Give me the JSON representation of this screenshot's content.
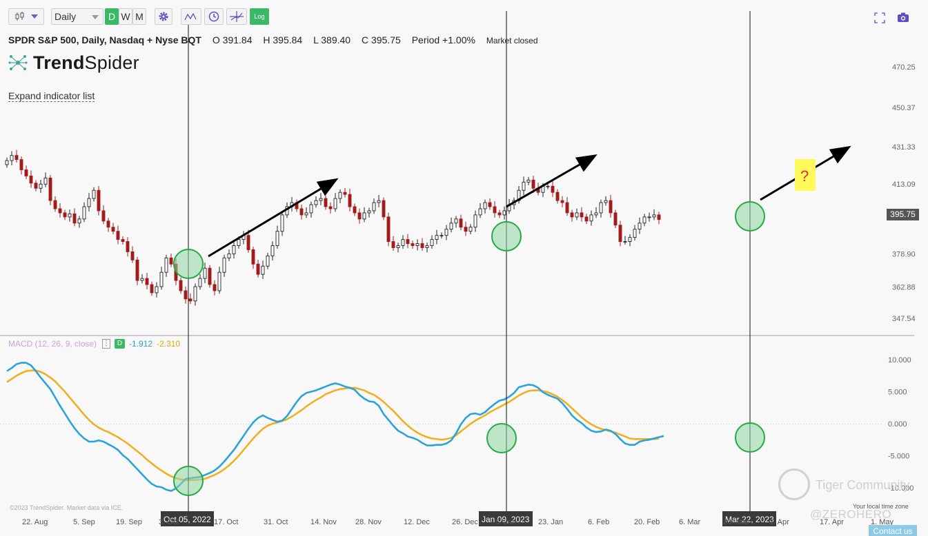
{
  "toolbar": {
    "interval_label": "Daily",
    "timeframes": [
      "D",
      "W",
      "M"
    ],
    "log_label": "Log"
  },
  "info": {
    "symbol": "SPDR S&P 500, Daily, Nasdaq + Nyse BQT",
    "open": "O 391.84",
    "high": "H 395.84",
    "low": "L 389.40",
    "close": "C 395.75",
    "period": "Period +1.00%",
    "status": "Market closed"
  },
  "logo": {
    "part1": "Trend",
    "part2": "Spider"
  },
  "expand_link": "Expand indicator list",
  "macd": {
    "name": "MACD (12, 26, 9, close)",
    "menu": "⋮",
    "badge": "D",
    "macd_value": "-1.912",
    "signal_value": "-2.310"
  },
  "copyright": "©2023 TrendSpider. Market data via ICE.",
  "watermark": {
    "text": "Tiger Community",
    "handle": "@ZEROHERO"
  },
  "timezone_note": "Your local time zone",
  "contact": "Contact us",
  "last_price": "395.75",
  "question_mark": "?",
  "colors": {
    "up": "#222222",
    "down": "#a31a1a",
    "macd": "#29a3dc",
    "signal": "#f0b020",
    "circle_stroke": "#22aa44",
    "circle_fill": "#8fd6a2",
    "accent_green": "#3cb968"
  },
  "chart_data": [
    {
      "type": "candlestick",
      "title": "SPDR S&P 500, Daily, Nasdaq + Nyse BQT",
      "y_ticks": [
        470.25,
        450.37,
        431.33,
        413.09,
        395.75,
        378.9,
        362.88,
        347.54
      ],
      "y_tick_labels": [
        "470.25",
        "450.37",
        "431.33",
        "413.09",
        "",
        "378.90",
        "362.88",
        "347.54"
      ],
      "ylim": [
        342,
        476
      ],
      "x_tick_labels": [
        "22. Aug",
        "5. Sep",
        "19. Sep",
        "3. Oct",
        "17. Oct",
        "31. Oct",
        "14. Nov",
        "28. Nov",
        "12. Dec",
        "26. Dec",
        "9. Jan",
        "23. Jan",
        "6. Feb",
        "20. Feb",
        "6. Mar",
        "20. Mar",
        "3. Apr",
        "17. Apr",
        "1. May"
      ],
      "crosshair_dates": [
        "Oct 05, 2022",
        "Jan 09, 2023",
        "Mar 22, 2023"
      ],
      "close": [
        424.5,
        427,
        425,
        420,
        417,
        413.5,
        411,
        413,
        416,
        405,
        401,
        399,
        397,
        398.5,
        394,
        396,
        402,
        406,
        410,
        400,
        395,
        392,
        390,
        386,
        385,
        380,
        376,
        366,
        367,
        364,
        360,
        363,
        370,
        377,
        374,
        366,
        361,
        357,
        356,
        363,
        367,
        372,
        364,
        361,
        370,
        377,
        379,
        383,
        386,
        388,
        381,
        374,
        369,
        373,
        378,
        383,
        390,
        398,
        402,
        404,
        401,
        398,
        399,
        403,
        405,
        406,
        402,
        401,
        406,
        409,
        408,
        402,
        399,
        396,
        399,
        400,
        404,
        405,
        397,
        385,
        382,
        383,
        386,
        384,
        383,
        384,
        382,
        383,
        386,
        388,
        388,
        391,
        394,
        396,
        392,
        390,
        392,
        398,
        401,
        404,
        402,
        399,
        398,
        400,
        403,
        405,
        410,
        414,
        415,
        411,
        409,
        412,
        412,
        409,
        405,
        404,
        399,
        397,
        399,
        397,
        395,
        398,
        399,
        404,
        405,
        399,
        393,
        385,
        385,
        387,
        391,
        394,
        397,
        397,
        398,
        395.75
      ]
    },
    {
      "type": "line",
      "title": "MACD (12, 26, 9, close)",
      "y_ticks": [
        10,
        5,
        0,
        -5,
        -10
      ],
      "y_tick_labels": [
        "10.000",
        "5.000",
        "0.000",
        "-5.000",
        "-10.000"
      ],
      "ylim": [
        -12,
        13
      ],
      "series": [
        {
          "name": "MACD",
          "values": [
            8.2,
            8.7,
            9.3,
            9.5,
            9.5,
            9.1,
            8.2,
            7.2,
            6.3,
            5.4,
            4.1,
            2.8,
            1.6,
            0.4,
            -0.7,
            -1.6,
            -2.3,
            -2.8,
            -2.8,
            -2.6,
            -2.8,
            -3.2,
            -3.6,
            -4.1,
            -4.9,
            -5.5,
            -6.3,
            -7.1,
            -7.9,
            -8.7,
            -9.4,
            -9.8,
            -9.9,
            -10.3,
            -10.5,
            -10.1,
            -9.4,
            -8.6,
            -8.5,
            -8.4,
            -8.3,
            -8.0,
            -7.7,
            -7.3,
            -6.7,
            -5.9,
            -5.0,
            -4.1,
            -3.0,
            -1.9,
            -0.8,
            0.2,
            0.9,
            1.3,
            0.9,
            0.6,
            0.3,
            0.5,
            1.2,
            2.3,
            3.4,
            4.3,
            4.8,
            5.0,
            5.2,
            5.5,
            5.8,
            6.1,
            6.3,
            6.1,
            5.8,
            5.6,
            5.3,
            4.5,
            3.9,
            3.5,
            3.4,
            2.8,
            1.5,
            0.6,
            -0.3,
            -1.1,
            -1.5,
            -2.0,
            -2.2,
            -2.5,
            -3.0,
            -3.4,
            -3.4,
            -3.3,
            -3.3,
            -3.1,
            -2.6,
            -1.5,
            -0.1,
            0.9,
            1.5,
            1.6,
            1.4,
            1.8,
            2.5,
            3.1,
            3.6,
            3.8,
            4.2,
            4.8,
            5.7,
            5.9,
            6.1,
            6.0,
            5.6,
            4.9,
            4.5,
            4.2,
            3.9,
            3.2,
            2.3,
            1.3,
            0.6,
            0.1,
            -0.6,
            -1.1,
            -1.3,
            -1.2,
            -0.9,
            -1.1,
            -1.6,
            -2.4,
            -3.1,
            -3.3,
            -3.3,
            -2.8,
            -2.6,
            -2.5,
            -2.3,
            -2.1,
            -1.912
          ]
        },
        {
          "name": "Signal",
          "values": [
            6.5,
            7.0,
            7.5,
            7.9,
            8.2,
            8.3,
            8.3,
            8.1,
            7.7,
            7.2,
            6.6,
            5.8,
            5.0,
            4.1,
            3.2,
            2.3,
            1.4,
            0.6,
            -0.1,
            -0.6,
            -1.0,
            -1.3,
            -1.7,
            -2.1,
            -2.6,
            -3.1,
            -3.7,
            -4.3,
            -4.9,
            -5.6,
            -6.2,
            -6.8,
            -7.3,
            -7.8,
            -8.2,
            -8.5,
            -8.7,
            -8.8,
            -8.8,
            -8.8,
            -8.7,
            -8.6,
            -8.3,
            -8.0,
            -7.6,
            -7.1,
            -6.5,
            -5.8,
            -5.0,
            -4.1,
            -3.2,
            -2.3,
            -1.5,
            -0.8,
            -0.3,
            0.0,
            0.2,
            0.4,
            0.7,
            1.1,
            1.6,
            2.1,
            2.7,
            3.2,
            3.7,
            4.1,
            4.6,
            4.9,
            5.2,
            5.4,
            5.5,
            5.6,
            5.6,
            5.4,
            5.2,
            4.8,
            4.5,
            4.0,
            3.4,
            2.7,
            2.0,
            1.2,
            0.4,
            -0.3,
            -0.9,
            -1.4,
            -1.8,
            -2.1,
            -2.3,
            -2.4,
            -2.5,
            -2.4,
            -2.2,
            -1.8,
            -1.2,
            -0.6,
            0.0,
            0.5,
            0.9,
            1.3,
            1.8,
            2.2,
            2.6,
            3.0,
            3.4,
            3.9,
            4.4,
            4.8,
            5.1,
            5.2,
            5.2,
            5.1,
            4.9,
            4.6,
            4.2,
            3.7,
            3.1,
            2.4,
            1.7,
            1.0,
            0.4,
            -0.1,
            -0.5,
            -0.8,
            -1.0,
            -1.2,
            -1.4,
            -1.7,
            -2.0,
            -2.3,
            -2.4,
            -2.4,
            -2.4,
            -2.4,
            -2.4,
            -2.31
          ]
        }
      ]
    }
  ]
}
